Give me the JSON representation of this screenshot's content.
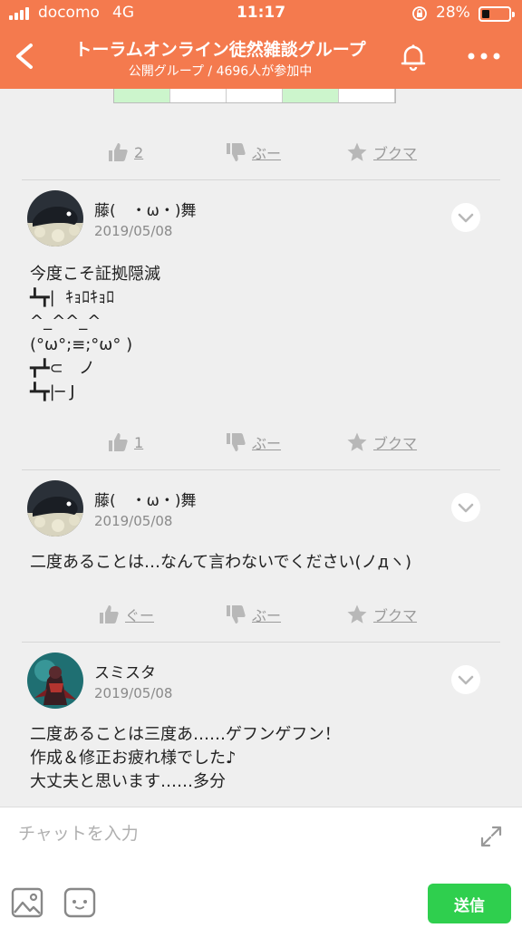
{
  "status_bar": {
    "carrier": "docomo",
    "network": "4G",
    "time": "11:17",
    "battery_percent": "28%",
    "battery_level": 0.28
  },
  "header": {
    "title": "トーラムオンライン徒然雑談グループ",
    "subtitle": "公開グループ / 4696人が参加中",
    "icons": [
      "back-icon",
      "bell-icon",
      "more-icon"
    ]
  },
  "actions_labels": {
    "like": "ぐー",
    "dislike": "ぶー",
    "bookmark": "ブクマ"
  },
  "top_actions": {
    "like_count": "2"
  },
  "posts": [
    {
      "author": "藤(　・ω・)舞",
      "date": "2019/05/08",
      "body": "今度こそ証拠隠滅\n┻┳|  ｷｮﾛｷｮﾛ\n^_^^_^\n(°ω°;≡;°ω° )\n┳┻⊂   ノ\n┻┳|─ J",
      "like_count": "1"
    },
    {
      "author": "藤(　・ω・)舞",
      "date": "2019/05/08",
      "body": "二度あることは…なんて言わないでください(ノдヽ)",
      "like_count": ""
    },
    {
      "author": "スミスタ",
      "date": "2019/05/08",
      "body": "二度あることは三度あ……ゲフンゲフン！\n作成＆修正お疲れ様でした♪\n大丈夫と思います……多分"
    }
  ],
  "input": {
    "placeholder": "チャットを入力",
    "send_label": "送信"
  },
  "colors": {
    "header": "#f47a4e",
    "send": "#2fcf4e",
    "muted": "#9a9a9a"
  }
}
